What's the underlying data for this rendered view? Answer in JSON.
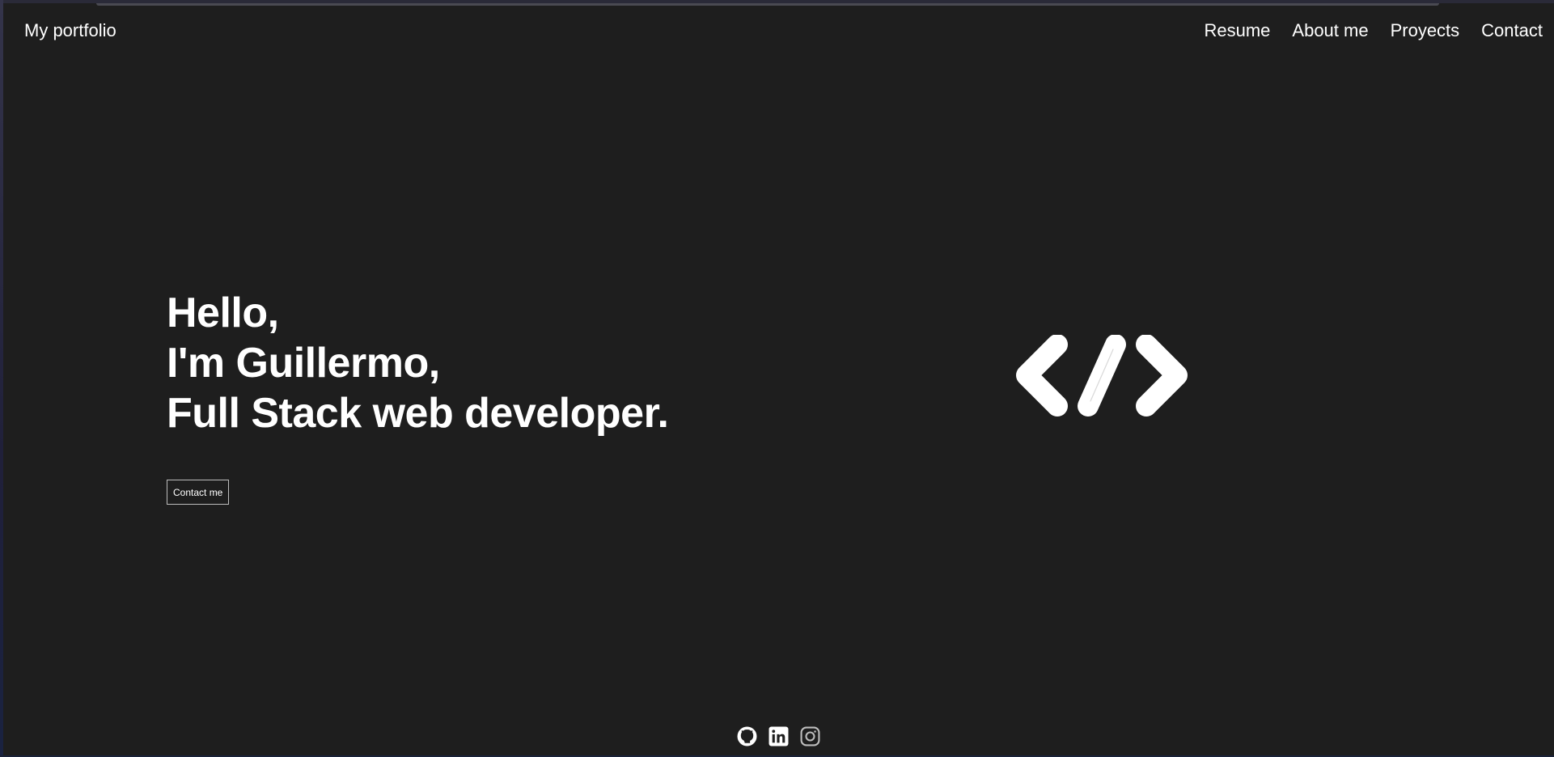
{
  "nav": {
    "brand": "My portfolio",
    "links": [
      "Resume",
      "About me",
      "Proyects",
      "Contact"
    ]
  },
  "hero": {
    "lines": [
      "Hello,",
      "I'm Guillermo,",
      "Full Stack web developer."
    ],
    "cta_label": "Contact me"
  },
  "logo": {
    "icon": "code-brackets-icon"
  },
  "socials": [
    {
      "icon": "github-icon"
    },
    {
      "icon": "linkedin-icon"
    },
    {
      "icon": "instagram-icon"
    }
  ],
  "colors": {
    "background": "#1e1e1e",
    "text": "#ffffff",
    "instagram": "#bdbdbd"
  }
}
